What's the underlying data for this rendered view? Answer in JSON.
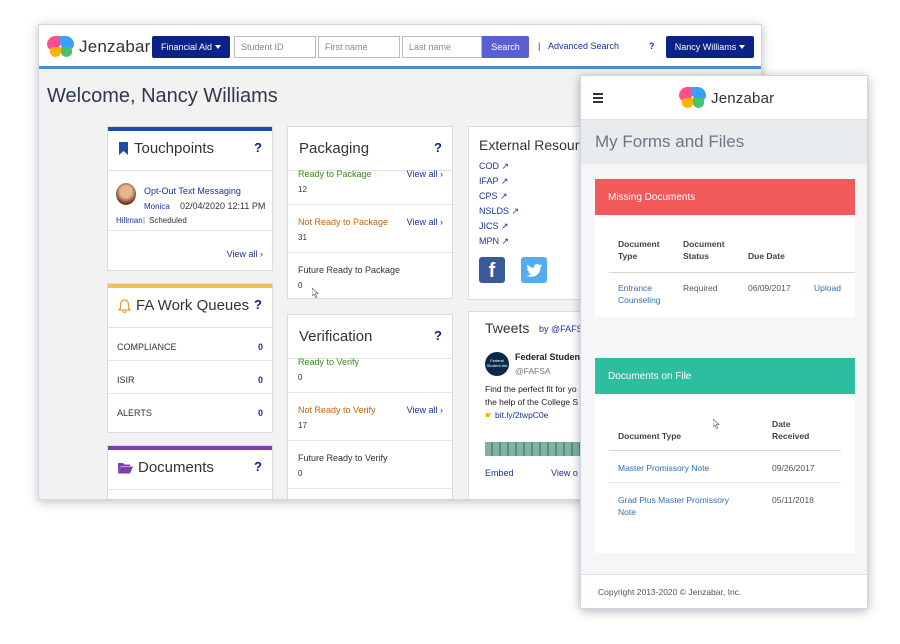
{
  "desktop": {
    "brand": "Jenzabar",
    "module_button": "Financial Aid",
    "student_id_placeholder": "Student ID",
    "first_name_placeholder": "First name",
    "last_name_placeholder": "Last name",
    "search_button": "Search",
    "separator": "|",
    "advanced_search": "Advanced Search",
    "help": "?",
    "user_button": "Nancy Williams",
    "welcome": "Welcome, Nancy Williams",
    "touchpoints": {
      "title": "Touchpoints",
      "help": "?",
      "item_title": "Opt-Out Text Messaging",
      "item_person": "Monica",
      "item_datetime": "02/04/2020 12:11 PM",
      "item_author": "Hillman",
      "item_sep": "|",
      "item_status": "Scheduled",
      "view_all": "View all ›",
      "stripe_color": "#1f4aa8"
    },
    "work_queues": {
      "title": "FA Work Queues",
      "help": "?",
      "stripe_color": "#f0c060",
      "rows": [
        {
          "label": "COMPLIANCE",
          "count": "0"
        },
        {
          "label": "ISIR",
          "count": "0"
        },
        {
          "label": "ALERTS",
          "count": "0"
        }
      ]
    },
    "documents": {
      "title": "Documents",
      "help": "?",
      "stripe_color": "#7b3fb0"
    },
    "packaging": {
      "title": "Packaging",
      "help": "?",
      "rows": [
        {
          "label": "Ready to Package",
          "count": "12",
          "view": "View all ›"
        },
        {
          "label": "Not Ready to Package",
          "count": "31",
          "view": "View all ›"
        },
        {
          "label": "Future Ready to Package",
          "count": "0",
          "view": ""
        }
      ]
    },
    "verification": {
      "title": "Verification",
      "help": "?",
      "rows": [
        {
          "label": "Ready to Verify",
          "count": "0",
          "view": ""
        },
        {
          "label": "Not Ready to Verify",
          "count": "17",
          "view": "View all ›"
        },
        {
          "label": "Future Ready to Verify",
          "count": "0",
          "view": ""
        }
      ]
    },
    "external": {
      "title": "External Resour",
      "links": [
        "COD",
        "IFAP",
        "CPS",
        "NSLDS",
        "JICS",
        "MPN"
      ]
    },
    "tweets": {
      "title": "Tweets",
      "by": "by @FAFS",
      "account_name": "Federal Student",
      "account_handle": "@FAFSA",
      "avatar_text": "Federal Student Aid",
      "text_line1": "Find the perfect fit for yo",
      "text_line2": "the help of the College S",
      "link": "bit.ly/2twpC0e",
      "embed": "Embed",
      "view_on": "View o"
    }
  },
  "mobile": {
    "brand": "Jenzabar",
    "title": "My Forms and Files",
    "missing": {
      "header": "Missing Documents",
      "header_color": "#f05a5b",
      "col_type": "Document Type",
      "col_status": "Document Status",
      "col_due": "Due Date",
      "rows": [
        {
          "type": "Entrance Counseling",
          "status": "Required",
          "due": "06/09/2017",
          "action": "Upload"
        }
      ]
    },
    "on_file": {
      "header": "Documents on File",
      "header_color": "#2bbfa0",
      "col_type": "Document Type",
      "col_received": "Date Received",
      "rows": [
        {
          "type": "Master Promissory Note",
          "received": "09/26/2017"
        },
        {
          "type": "Grad Plus Master Promissory Note",
          "received": "05/11/2018"
        }
      ]
    },
    "footer": "Copyright 2013-2020 © Jenzabar, Inc."
  }
}
